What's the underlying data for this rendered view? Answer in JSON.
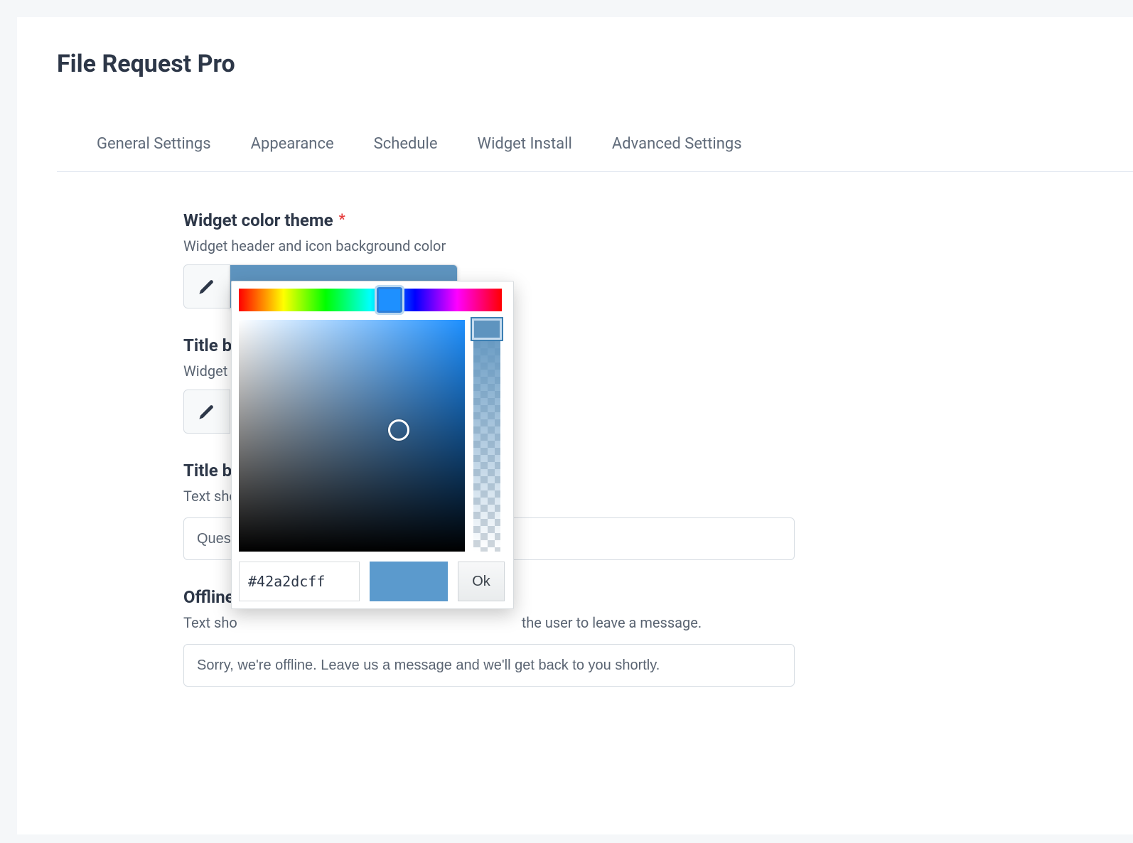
{
  "header": {
    "title": "File Request Pro"
  },
  "tabs": [
    {
      "label": "General Settings"
    },
    {
      "label": "Appearance"
    },
    {
      "label": "Schedule"
    },
    {
      "label": "Widget Install"
    },
    {
      "label": "Advanced Settings"
    }
  ],
  "fields": {
    "widget_color": {
      "label": "Widget color theme",
      "required_mark": "*",
      "help": "Widget header and icon background color",
      "swatch_color": "#5e94bf"
    },
    "title_bar_color": {
      "label": "Title ba",
      "help": "Widget h"
    },
    "title_bar_text": {
      "label": "Title ba",
      "help": "Text sho",
      "value_fragment": "Questi"
    },
    "offline": {
      "label": "Offline",
      "help_prefix": "Text sho",
      "help_suffix": "the user to leave a message.",
      "value": "Sorry, we're offline. Leave us a message and we'll get back to you shortly."
    }
  },
  "picker": {
    "hex_value": "#42a2dcff",
    "ok_label": "Ok",
    "hue_color": "#1e90ff",
    "preview_color": "#5b9acd"
  },
  "icons": {
    "eyedropper": "eyedropper-icon"
  }
}
